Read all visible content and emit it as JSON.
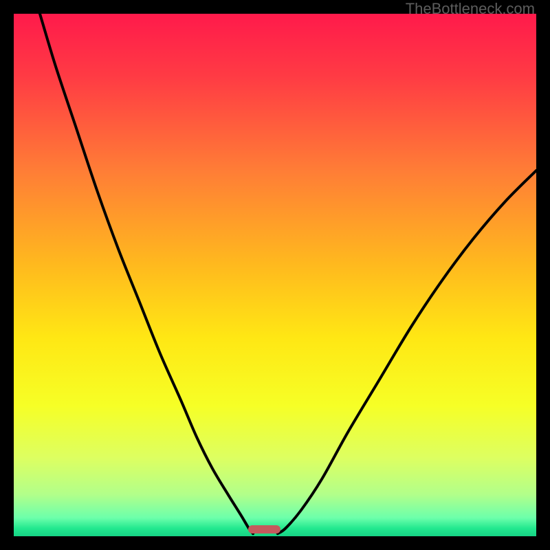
{
  "watermark": "TheBottleneck.com",
  "chart_data": {
    "type": "line",
    "title": "",
    "xlabel": "",
    "ylabel": "",
    "xlim": [
      0,
      100
    ],
    "ylim": [
      0,
      100
    ],
    "gradient_stops": [
      {
        "offset": 0,
        "color": "#ff1a4b"
      },
      {
        "offset": 0.12,
        "color": "#ff3b44"
      },
      {
        "offset": 0.3,
        "color": "#ff7d36"
      },
      {
        "offset": 0.48,
        "color": "#ffb91e"
      },
      {
        "offset": 0.62,
        "color": "#ffe714"
      },
      {
        "offset": 0.75,
        "color": "#f6ff26"
      },
      {
        "offset": 0.85,
        "color": "#ddff61"
      },
      {
        "offset": 0.92,
        "color": "#b2ff8a"
      },
      {
        "offset": 0.965,
        "color": "#6cffab"
      },
      {
        "offset": 0.985,
        "color": "#22e88f"
      },
      {
        "offset": 1.0,
        "color": "#17d385"
      }
    ],
    "series": [
      {
        "name": "left-branch",
        "x": [
          5,
          8,
          12,
          16,
          20,
          24,
          28,
          32,
          35,
          38,
          41,
          43.5,
          45,
          45.8
        ],
        "y": [
          100,
          90,
          78,
          66,
          55,
          45,
          35,
          26,
          19,
          13,
          8,
          4,
          1.5,
          0.5
        ]
      },
      {
        "name": "right-branch",
        "x": [
          50.5,
          52,
          55,
          59,
          64,
          70,
          76,
          82,
          88,
          94,
          100
        ],
        "y": [
          0.5,
          1.5,
          5,
          11,
          20,
          30,
          40,
          49,
          57,
          64,
          70
        ]
      }
    ],
    "marker": {
      "x_center_pct": 48.0,
      "y_from_bottom_pct": 1.3,
      "width_pct": 6.2,
      "height_pct": 1.6,
      "color": "#c45a5d"
    }
  }
}
